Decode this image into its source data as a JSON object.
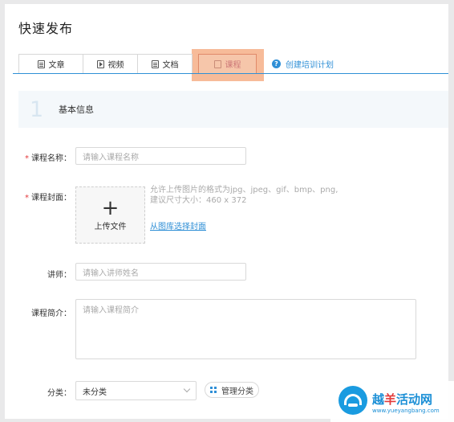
{
  "page": {
    "title": "快速发布"
  },
  "tabs": [
    {
      "label": "文章",
      "icon": "article-icon"
    },
    {
      "label": "视频",
      "icon": "video-icon"
    },
    {
      "label": "文档",
      "icon": "document-icon"
    },
    {
      "label": "课程",
      "icon": "course-icon"
    }
  ],
  "help_link": {
    "label": "创建培训计划",
    "icon": "question-icon"
  },
  "section": {
    "number": "1",
    "title": "基本信息"
  },
  "form": {
    "course_name": {
      "label": "课程名称：",
      "required_mark": "*",
      "placeholder": "请输入课程名称"
    },
    "cover": {
      "label": "课程封面：",
      "required_mark": "*",
      "upload_plus": "+",
      "upload_label": "上传文件",
      "hint_line1": "允许上传图片的格式为jpg、jpeg、gif、bmp、png,",
      "hint_line2": "建议尺寸大小：460 x 372",
      "gallery_link": "从图库选择封面"
    },
    "lecturer": {
      "label": "讲师：",
      "placeholder": "请输入讲师姓名"
    },
    "intro": {
      "label": "课程简介：",
      "placeholder": "请输入课程简介"
    },
    "category": {
      "label": "分类：",
      "selected": "未分类",
      "manage_label": "管理分类"
    }
  },
  "watermark": {
    "text_blue": "越",
    "text_red": "羊",
    "text_rest": "活动网",
    "url": "www.yueyangbang.com"
  },
  "colors": {
    "accent": "#2f8fd6",
    "required": "#e4393c",
    "highlight": "#f6b48e"
  }
}
